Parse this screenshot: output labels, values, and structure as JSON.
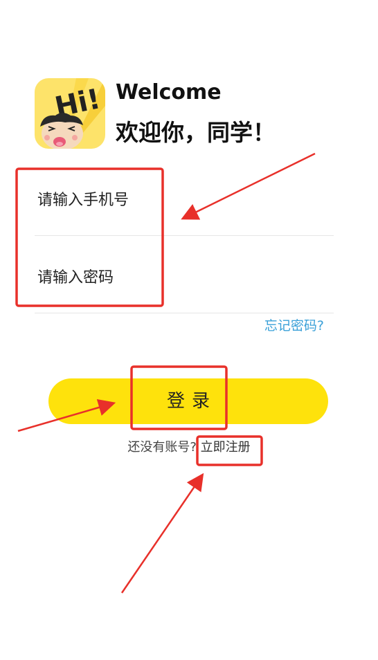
{
  "header": {
    "welcome": "Welcome",
    "greeting": "欢迎你，同学！"
  },
  "logo": {
    "icon": "hi-cartoon-boy-logo",
    "text": "Hi!"
  },
  "form": {
    "phone_placeholder": "请输入手机号",
    "password_placeholder": "请输入密码",
    "forgot_password": "忘记密码?"
  },
  "login": {
    "label": "登录"
  },
  "register": {
    "prompt": "还没有账号?",
    "link": "立即注册"
  },
  "colors": {
    "accent_yellow": "#fee20c",
    "link_blue": "#3aa0d8",
    "annotation_red": "#e8302a"
  }
}
